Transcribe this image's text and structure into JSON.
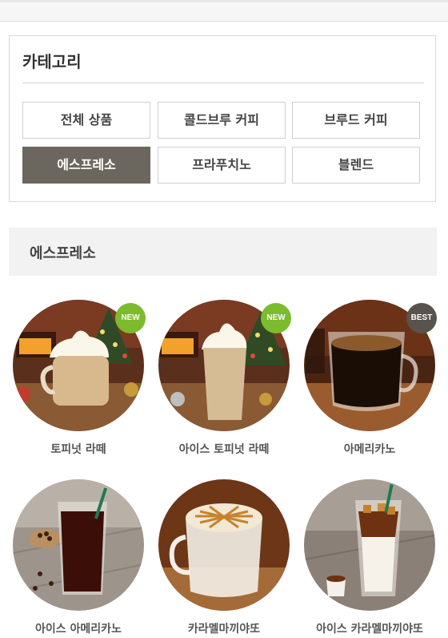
{
  "category": {
    "title": "카테고리",
    "buttons": [
      {
        "label": "전체 상품",
        "active": false
      },
      {
        "label": "콜드브루 커피",
        "active": false
      },
      {
        "label": "브루드 커피",
        "active": false
      },
      {
        "label": "에스프레소",
        "active": true
      },
      {
        "label": "프라푸치노",
        "active": false
      },
      {
        "label": "블렌드",
        "active": false
      }
    ]
  },
  "section": {
    "title": "에스프레소"
  },
  "products": [
    {
      "name": "토피넛 라떼",
      "badge": "NEW",
      "image": "toffee-nut-latte-image"
    },
    {
      "name": "아이스 토피넛 라떼",
      "badge": "NEW",
      "image": "iced-toffee-nut-latte-image"
    },
    {
      "name": "아메리카노",
      "badge": "BEST",
      "image": "americano-image"
    },
    {
      "name": "아이스 아메리카노",
      "badge": "",
      "image": "iced-americano-image"
    },
    {
      "name": "카라멜마끼야또",
      "badge": "",
      "image": "caramel-macchiato-image"
    },
    {
      "name": "아이스 카라멜마끼야또",
      "badge": "",
      "image": "iced-caramel-macchiato-image"
    }
  ],
  "colors": {
    "active": "#6b675e",
    "new_badge": "#7cbb2d",
    "best_badge": "#58534c"
  }
}
